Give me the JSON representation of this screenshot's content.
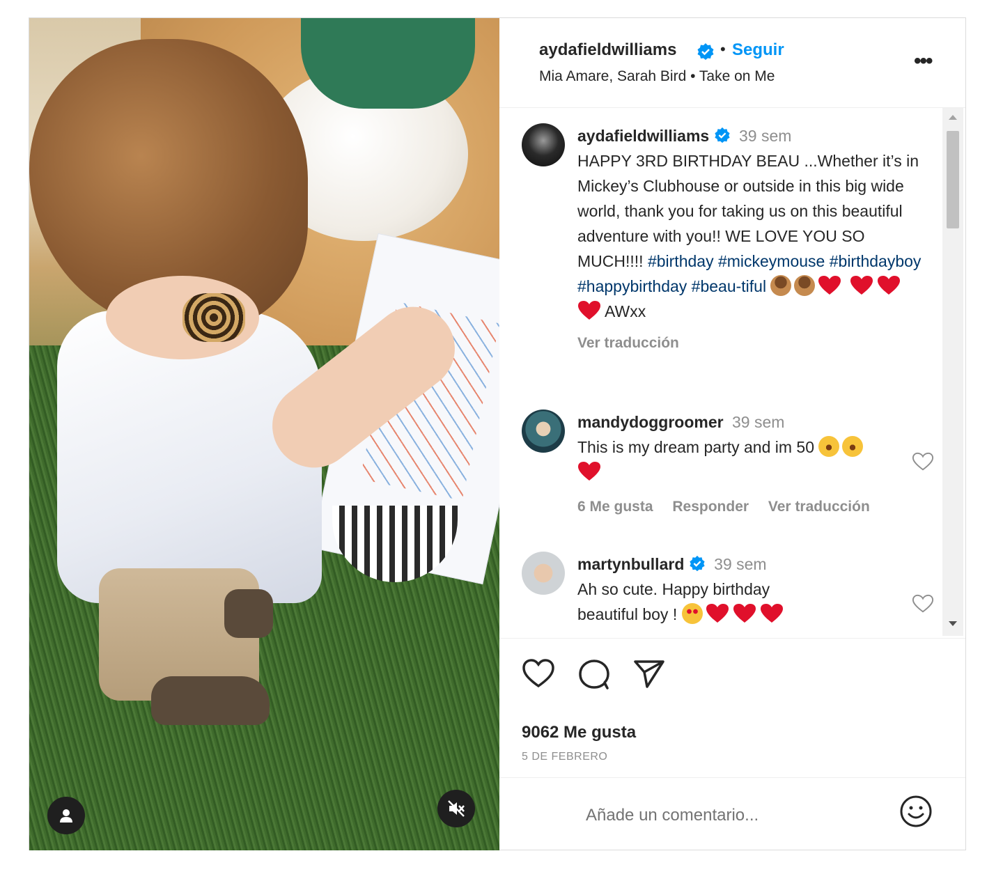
{
  "post": {
    "author": "aydafieldwilliams",
    "follow_label": "Seguir",
    "separator": "•",
    "audio": "Mia Amare, Sarah Bird • Take on Me",
    "more_label": "•••"
  },
  "caption": {
    "username": "aydafieldwilliams",
    "time": "39 sem",
    "text": "HAPPY 3RD BIRTHDAY BEAU ...Whether it’s in Mickey’s Clubhouse or outside in this big wide world, thank you for taking us on this beautiful adventure with you!! WE LOVE YOU SO MUCH!!!!",
    "hashtags": "#birthday #mickeymouse #birthdayboy #happybirthday #beau-tiful",
    "signoff": "AWxx",
    "translate": "Ver traducción"
  },
  "comments": [
    {
      "username": "mandydoggroomer",
      "time": "39 sem",
      "text": "This is my dream party and im 50",
      "likes": "6 Me gusta",
      "reply": "Responder",
      "translate": "Ver traducción"
    },
    {
      "username": "martynbullard",
      "time": "39 sem",
      "text": "Ah so cute. Happy birthday beautiful boy !"
    }
  ],
  "stats": {
    "likes": "9062 Me gusta",
    "date": "5 DE FEBRERO"
  },
  "composer": {
    "placeholder": "Añade un comentario..."
  },
  "colors": {
    "accent": "#0095f6",
    "hashtag": "#00376b",
    "heart": "#e0102b"
  }
}
